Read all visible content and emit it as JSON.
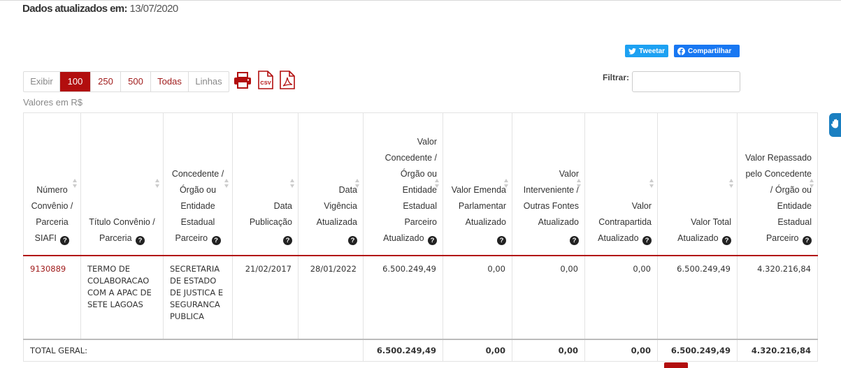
{
  "header": {
    "updated_label": "Dados atualizados em:",
    "updated_value": "13/07/2020"
  },
  "share": {
    "tweet_label": "Tweetar",
    "share_label": "Compartilhar"
  },
  "pager": {
    "show_label": "Exibir",
    "options": [
      "100",
      "250",
      "500",
      "Todas"
    ],
    "selected": "100",
    "rows_label": "Linhas"
  },
  "downloads": {
    "icons": [
      "printer-icon",
      "csv-icon",
      "pdf-icon"
    ],
    "csv_text": "CSV"
  },
  "filter": {
    "label": "Filtrar:",
    "value": "",
    "placeholder": ""
  },
  "currency_note": "Valores em R$",
  "colors": {
    "accent": "#b20e0e",
    "link": "#a01c1c",
    "twitter": "#1da1f2",
    "facebook": "#1877f2",
    "side_tab": "#1a7fc1"
  },
  "table": {
    "headers": [
      "Número Convênio / Parceria SIAFI",
      "Título Convênio / Parceria",
      "Concedente / Órgão ou Entidade Estadual Parceiro",
      "Data Publicação",
      "Data Vigência Atualizada",
      "Valor Concedente / Órgão ou Entidade Estadual Parceiro Atualizado",
      "Valor Emenda Parlamentar Atualizado",
      "Valor Interveniente / Outras Fontes Atualizado",
      "Valor Contrapartida Atualizado",
      "Valor Total Atualizado",
      "Valor Repassado pelo Concedente / Órgão ou Entidade Estadual Parceiro"
    ],
    "rows": [
      {
        "numero": "9130889",
        "titulo": "TERMO DE COLABORACAO COM A APAC DE SETE LAGOAS",
        "concedente": "SECRETARIA DE ESTADO DE JUSTICA E SEGURANCA PUBLICA",
        "data_publicacao": "21/02/2017",
        "data_vigencia": "28/01/2022",
        "valor_concedente": "6.500.249,49",
        "valor_emenda": "0,00",
        "valor_interveniente": "0,00",
        "valor_contrapartida": "0,00",
        "valor_total": "6.500.249,49",
        "valor_repassado": "4.320.216,84"
      }
    ],
    "footer": {
      "label": "TOTAL GERAL:",
      "valor_concedente": "6.500.249,49",
      "valor_emenda": "0,00",
      "valor_interveniente": "0,00",
      "valor_contrapartida": "0,00",
      "valor_total": "6.500.249,49",
      "valor_repassado": "4.320.216,84"
    }
  }
}
